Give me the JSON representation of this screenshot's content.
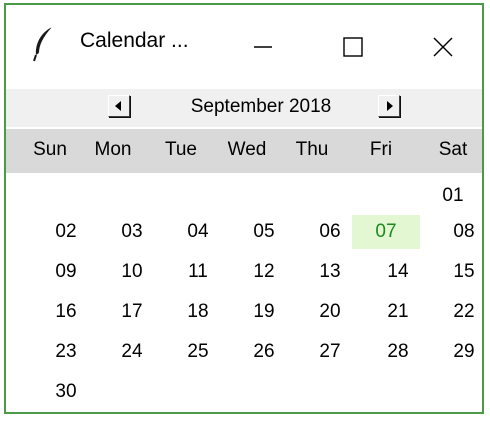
{
  "window": {
    "title": "Calendar ...",
    "minimize_icon": "minimize-icon",
    "maximize_icon": "maximize-icon",
    "close_icon": "close-icon",
    "app_icon": "feather-icon"
  },
  "nav": {
    "month_label": "September 2018",
    "prev_icon": "triangle-left-icon",
    "next_icon": "triangle-right-icon"
  },
  "weekdays": [
    "Sun",
    "Mon",
    "Tue",
    "Wed",
    "Thu",
    "Fri",
    "Sat"
  ],
  "days": {
    "d01": "01",
    "d02": "02",
    "d03": "03",
    "d04": "04",
    "d05": "05",
    "d06": "06",
    "d07": "07",
    "d08": "08",
    "d09": "09",
    "d10": "10",
    "d11": "11",
    "d12": "12",
    "d13": "13",
    "d14": "14",
    "d15": "15",
    "d16": "16",
    "d17": "17",
    "d18": "18",
    "d19": "19",
    "d20": "20",
    "d21": "21",
    "d22": "22",
    "d23": "23",
    "d24": "24",
    "d25": "25",
    "d26": "26",
    "d27": "27",
    "d28": "28",
    "d29": "29",
    "d30": "30"
  },
  "colors": {
    "today_bg": "#e2f7d2",
    "today_fg": "#1e8a1e",
    "header_bg": "#d9d9d9",
    "window_border": "#4b9a48"
  }
}
